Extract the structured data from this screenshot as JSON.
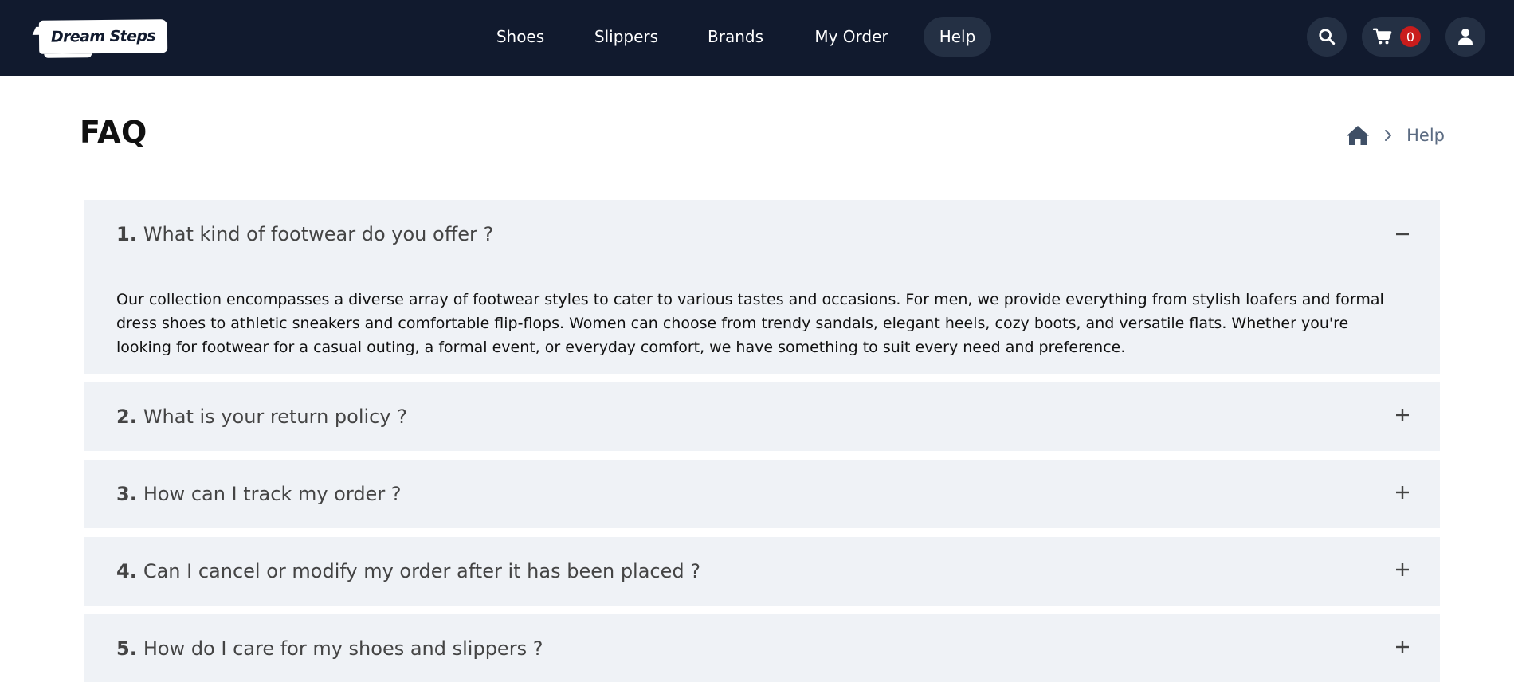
{
  "header": {
    "logo_text": "Dream Steps",
    "nav": [
      {
        "label": "Shoes"
      },
      {
        "label": "Slippers"
      },
      {
        "label": "Brands"
      },
      {
        "label": "My Order"
      },
      {
        "label": "Help",
        "active": true
      }
    ],
    "cart_count": "0",
    "icons": {
      "search": "search-icon",
      "cart": "cart-icon",
      "user": "user-icon"
    }
  },
  "page": {
    "title": "FAQ",
    "breadcrumb": {
      "home_icon": "home-icon",
      "current": "Help"
    }
  },
  "faq": [
    {
      "num": "1.",
      "question": "What kind of footwear do you offer ?",
      "expanded": true,
      "answer": "Our collection encompasses a diverse array of footwear styles to cater to various tastes and occasions. For men, we provide everything from stylish loafers and formal dress shoes to athletic sneakers and comfortable flip-flops. Women can choose from trendy sandals, elegant heels, cozy boots, and versatile flats. Whether you're looking for footwear for a casual outing, a formal event, or everyday comfort, we have something to suit every need and preference."
    },
    {
      "num": "2.",
      "question": "What is your return policy ?",
      "expanded": false
    },
    {
      "num": "3.",
      "question": "How can I track my order ?",
      "expanded": false
    },
    {
      "num": "4.",
      "question": "Can I cancel or modify my order after it has been placed ?",
      "expanded": false
    },
    {
      "num": "5.",
      "question": "How do I care for my shoes and slippers ?",
      "expanded": false
    }
  ],
  "colors": {
    "header_bg": "#111a2e",
    "nav_active_bg": "#243044",
    "badge": "#c91c1c",
    "panel_bg": "#eff2f6",
    "breadcrumb": "#5b6b82"
  }
}
